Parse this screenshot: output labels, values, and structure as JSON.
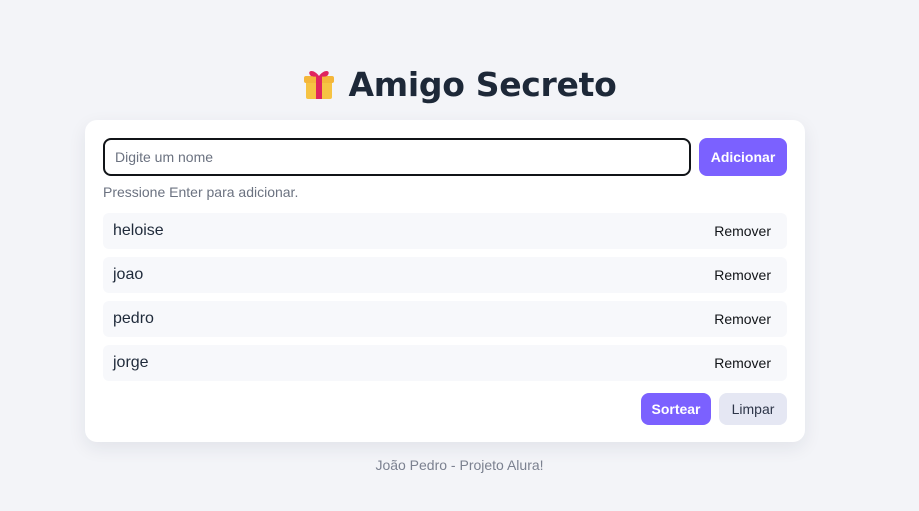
{
  "header": {
    "title": "Amigo Secreto",
    "icon": "gift-icon"
  },
  "form": {
    "input_placeholder": "Digite um nome",
    "input_value": "",
    "add_label": "Adicionar",
    "hint": "Pressione Enter para adicionar."
  },
  "list": {
    "items": [
      {
        "name": "heloise",
        "remove_label": "Remover"
      },
      {
        "name": "joao",
        "remove_label": "Remover"
      },
      {
        "name": "pedro",
        "remove_label": "Remover"
      },
      {
        "name": "jorge",
        "remove_label": "Remover"
      }
    ]
  },
  "actions": {
    "draw_label": "Sortear",
    "clear_label": "Limpar"
  },
  "footer": {
    "text": "João Pedro - Projeto Alura!"
  },
  "colors": {
    "accent": "#7b61ff",
    "background": "#f3f4f8",
    "secondary_button": "#e5e7f3"
  }
}
